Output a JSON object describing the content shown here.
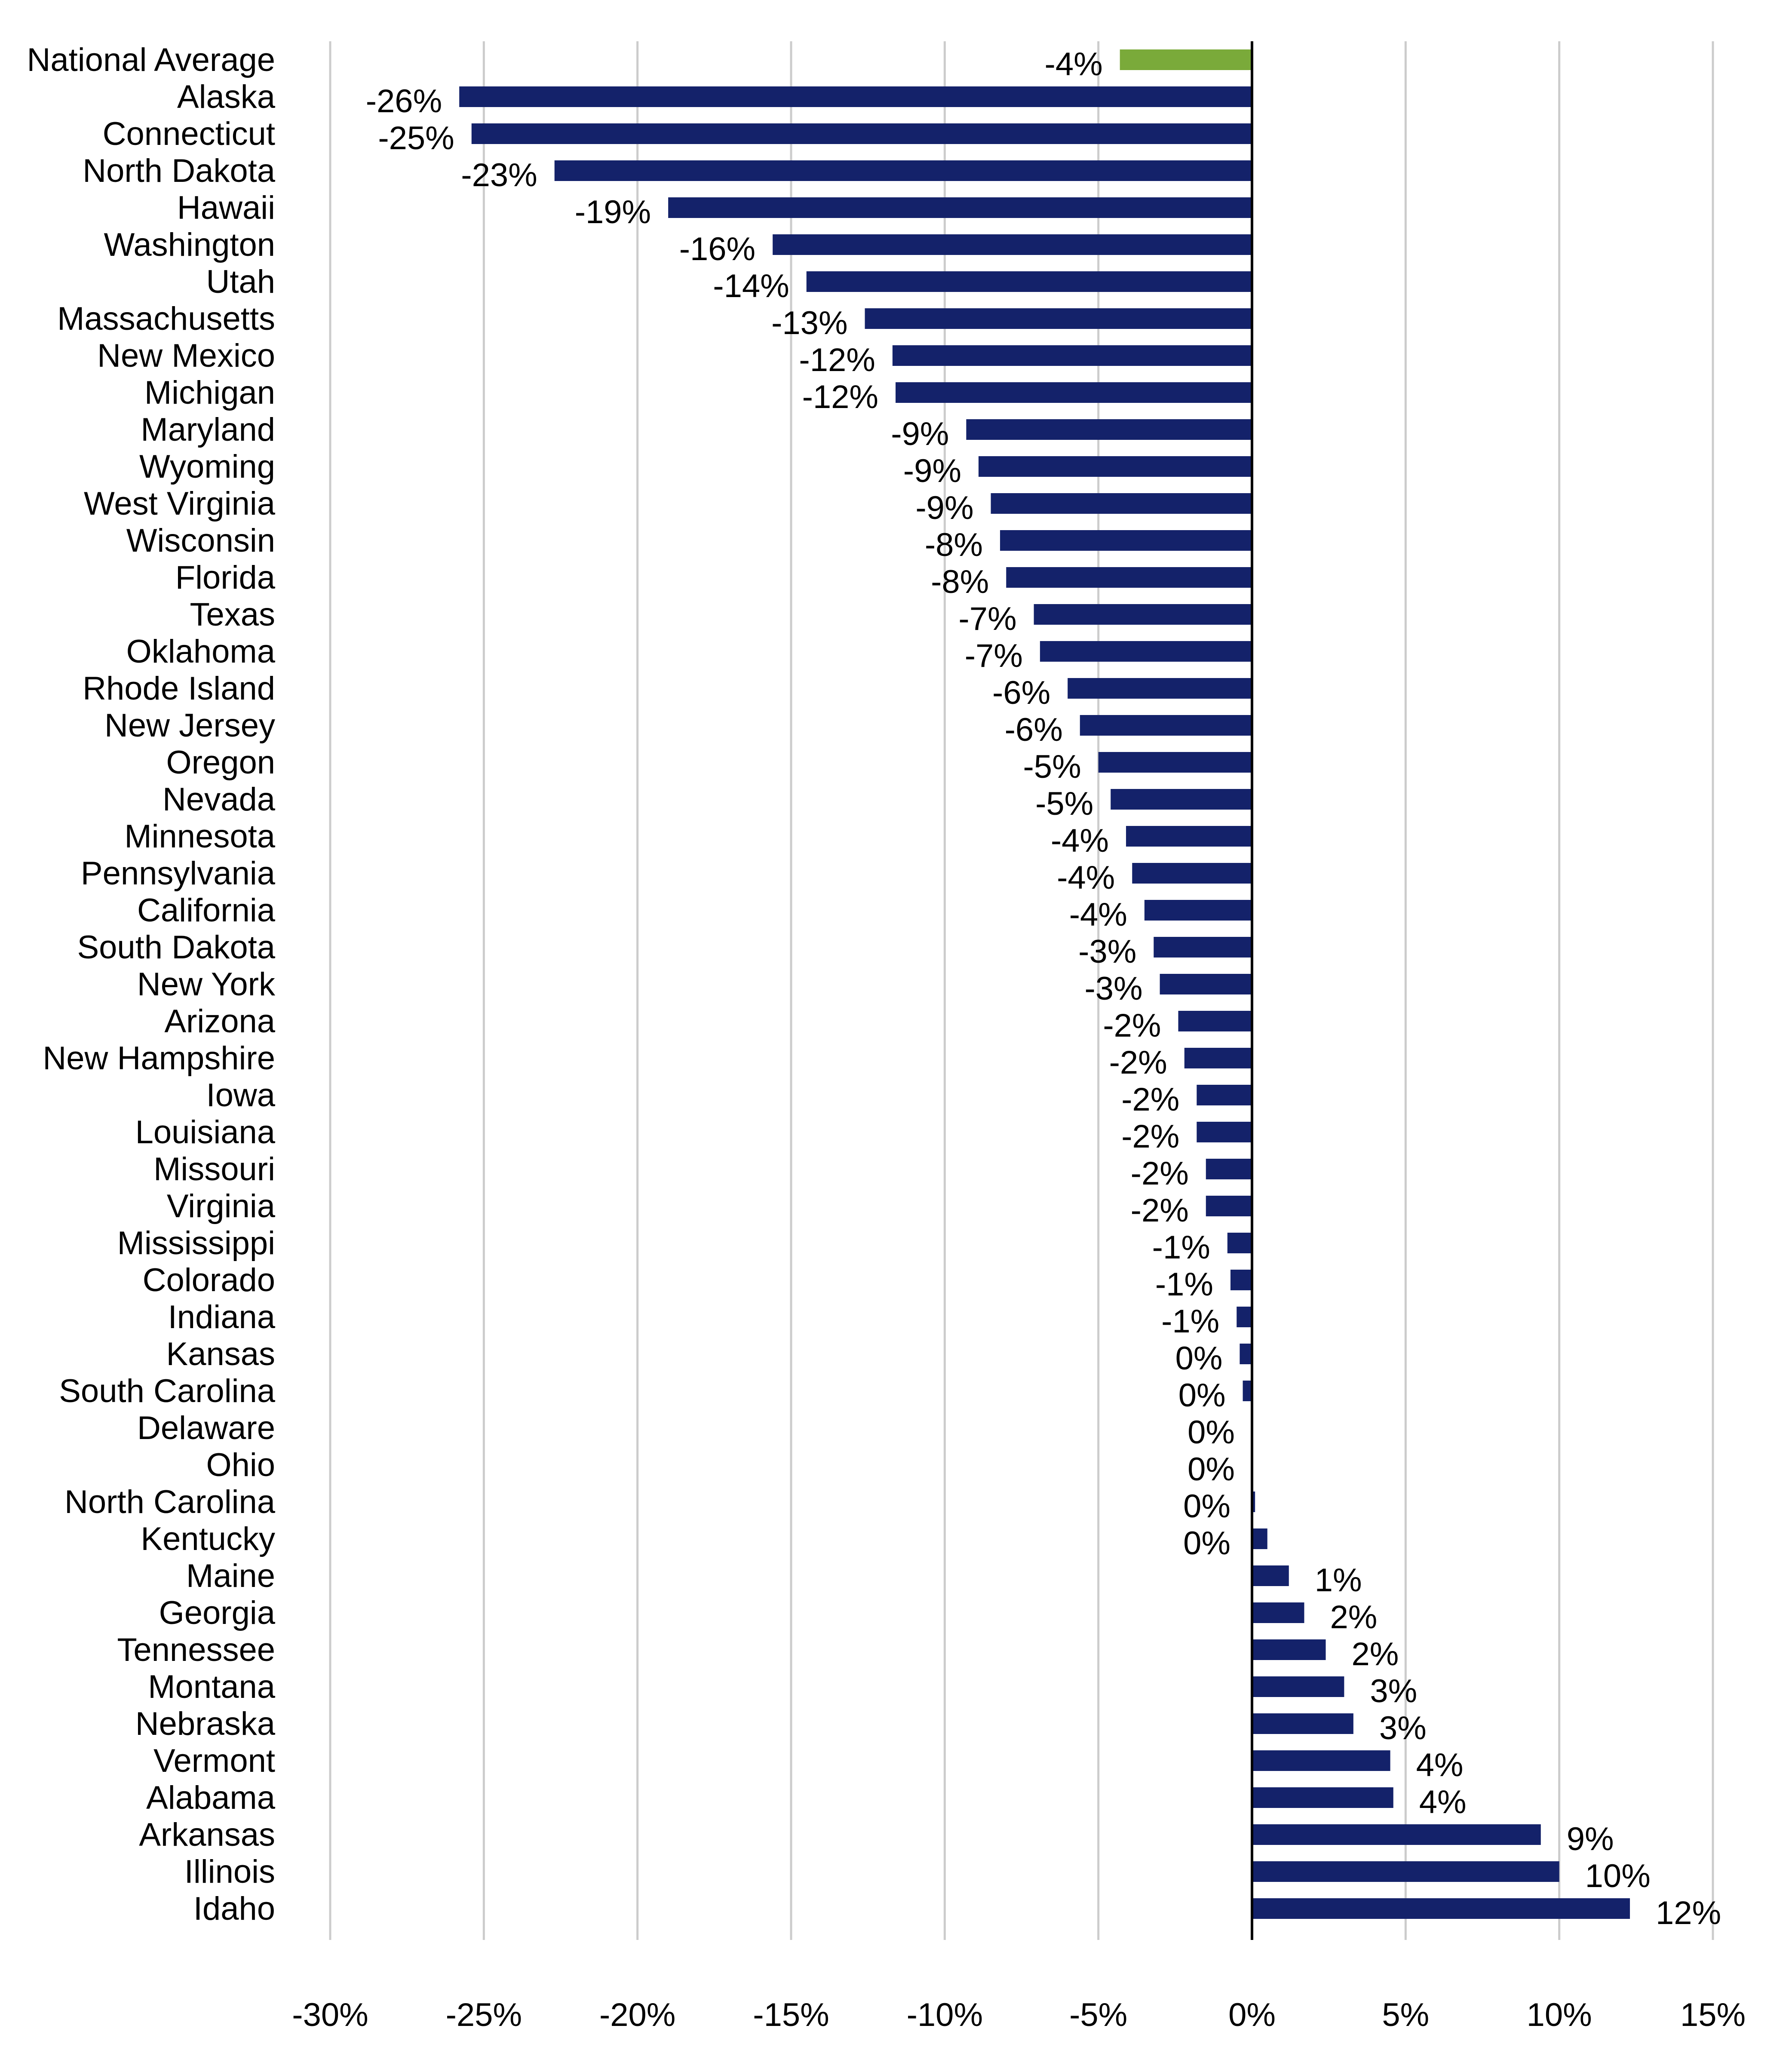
{
  "chart_data": {
    "type": "bar",
    "orientation": "horizontal",
    "title": "",
    "xlabel": "",
    "ylabel": "",
    "xlim": [
      -30,
      15
    ],
    "x_ticks": [
      -30,
      -25,
      -20,
      -15,
      -10,
      -5,
      0,
      5,
      10,
      15
    ],
    "x_tick_labels": [
      "-30%",
      "-25%",
      "-20%",
      "-15%",
      "-10%",
      "-5%",
      "0%",
      "5%",
      "10%",
      "15%"
    ],
    "grid": "vertical",
    "legend": "none",
    "colors": {
      "bar": "#14226a",
      "highlight": "#7aaa3a",
      "grid": "#cccccc",
      "axis": "#000000"
    },
    "categories": [
      "National Average",
      "Alaska",
      "Connecticut",
      "North Dakota",
      "Hawaii",
      "Washington",
      "Utah",
      "Massachusetts",
      "New Mexico",
      "Michigan",
      "Maryland",
      "Wyoming",
      "West Virginia",
      "Wisconsin",
      "Florida",
      "Texas",
      "Oklahoma",
      "Rhode Island",
      "New Jersey",
      "Oregon",
      "Nevada",
      "Minnesota",
      "Pennsylvania",
      "California",
      "South Dakota",
      "New York",
      "Arizona",
      "New Hampshire",
      "Iowa",
      "Louisiana",
      "Missouri",
      "Virginia",
      "Mississippi",
      "Colorado",
      "Indiana",
      "Kansas",
      "South Carolina",
      "Delaware",
      "Ohio",
      "North Carolina",
      "Kentucky",
      "Maine",
      "Georgia",
      "Tennessee",
      "Montana",
      "Nebraska",
      "Vermont",
      "Alabama",
      "Arkansas",
      "Illinois",
      "Idaho"
    ],
    "values": [
      -4.3,
      -25.8,
      -25.4,
      -22.7,
      -19.0,
      -15.6,
      -14.5,
      -12.6,
      -11.7,
      -11.6,
      -9.3,
      -8.9,
      -8.5,
      -8.2,
      -8.0,
      -7.1,
      -6.9,
      -6.0,
      -5.6,
      -5.0,
      -4.6,
      -4.1,
      -3.9,
      -3.5,
      -3.2,
      -3.0,
      -2.4,
      -2.2,
      -1.8,
      -1.8,
      -1.5,
      -1.5,
      -0.8,
      -0.7,
      -0.5,
      -0.4,
      -0.3,
      0.0,
      0.0,
      0.1,
      0.5,
      1.2,
      1.7,
      2.4,
      3.0,
      3.3,
      4.5,
      4.6,
      9.4,
      10.0,
      12.3
    ],
    "data_labels": [
      "-4%",
      "-26%",
      "-25%",
      "-23%",
      "-19%",
      "-16%",
      "-14%",
      "-13%",
      "-12%",
      "-12%",
      "-9%",
      "-9%",
      "-9%",
      "-8%",
      "-8%",
      "-7%",
      "-7%",
      "-6%",
      "-6%",
      "-5%",
      "-5%",
      "-4%",
      "-4%",
      "-4%",
      "-3%",
      "-3%",
      "-2%",
      "-2%",
      "-2%",
      "-2%",
      "-2%",
      "-2%",
      "-1%",
      "-1%",
      "-1%",
      "0%",
      "0%",
      "0%",
      "0%",
      "0%",
      "0%",
      "1%",
      "2%",
      "2%",
      "3%",
      "3%",
      "4%",
      "4%",
      "9%",
      "10%",
      "12%"
    ],
    "highlight_index": 0
  }
}
